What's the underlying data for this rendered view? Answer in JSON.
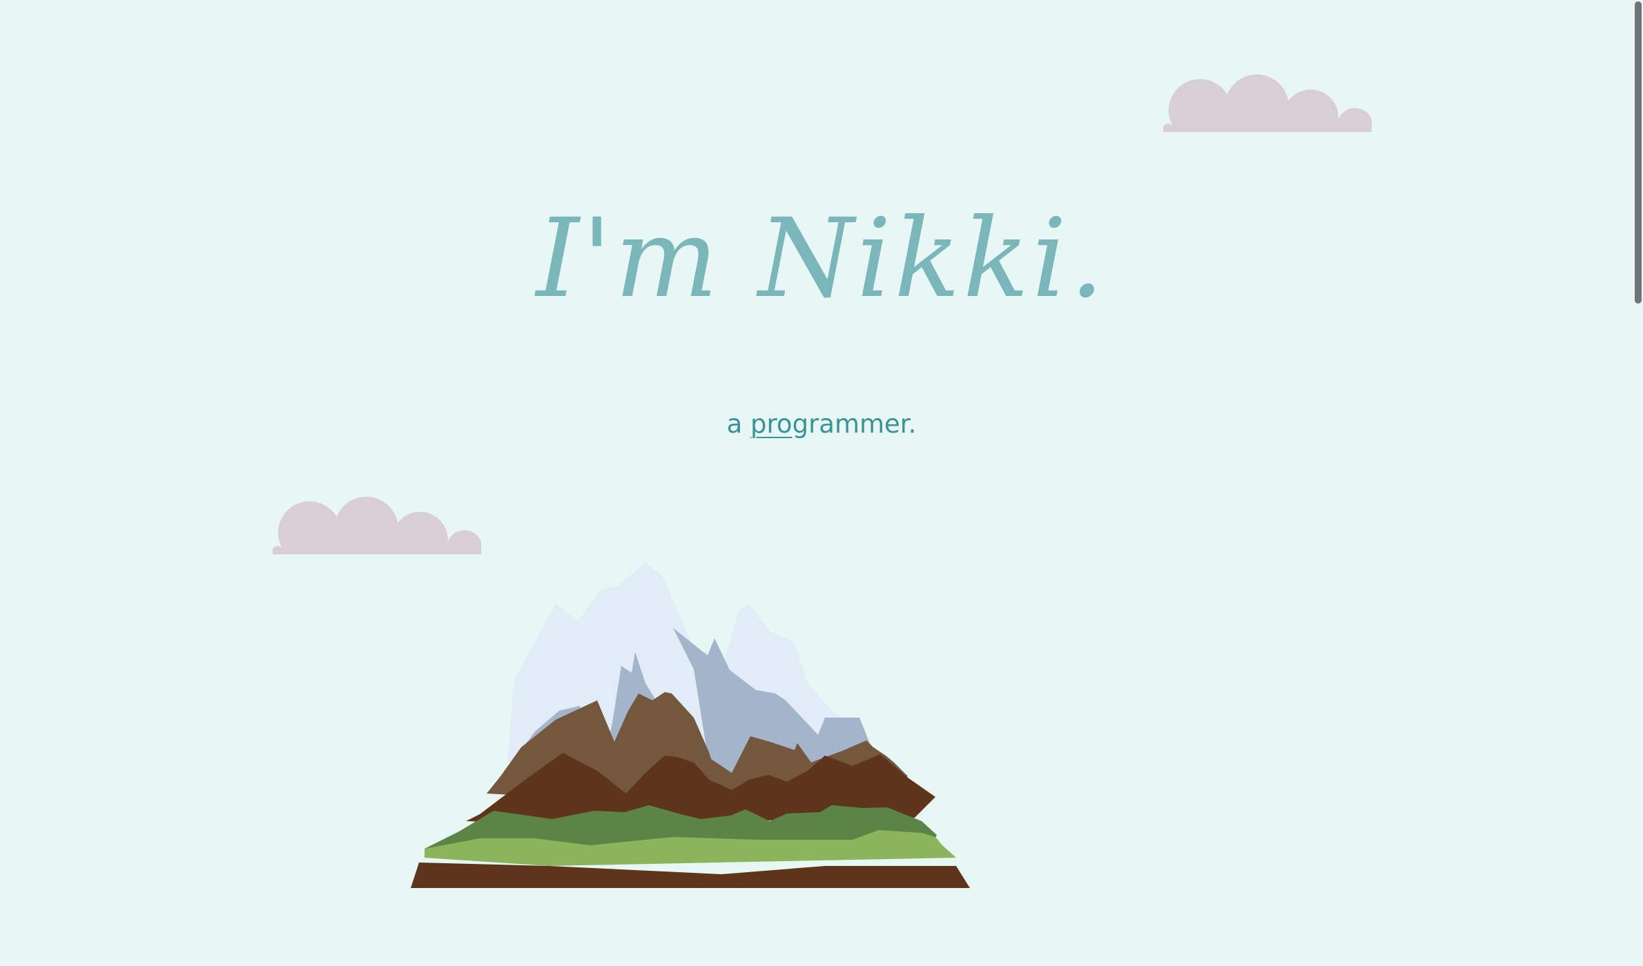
{
  "hero": {
    "title": "I'm Nikki."
  },
  "tagline": {
    "prefix": "a ",
    "underlined": "pro",
    "rest": "grammer."
  },
  "colors": {
    "background": "#e7f8f4",
    "title": "#7bb6ba",
    "tagline": "#3b9299",
    "cloud": "#d9ced6",
    "snow": "#e2ecf6",
    "snow_shadow": "#a4b4cb",
    "rock_light": "#73583d",
    "rock_dark": "#5e351b",
    "grass_dark": "#5b8446",
    "grass_light": "#8bb45b",
    "soil": "#5e351b",
    "scrollbar": "#6f7478"
  },
  "decorations": {
    "clouds": [
      "cloud-icon",
      "cloud-icon"
    ],
    "illustration": "mountain-illustration"
  }
}
